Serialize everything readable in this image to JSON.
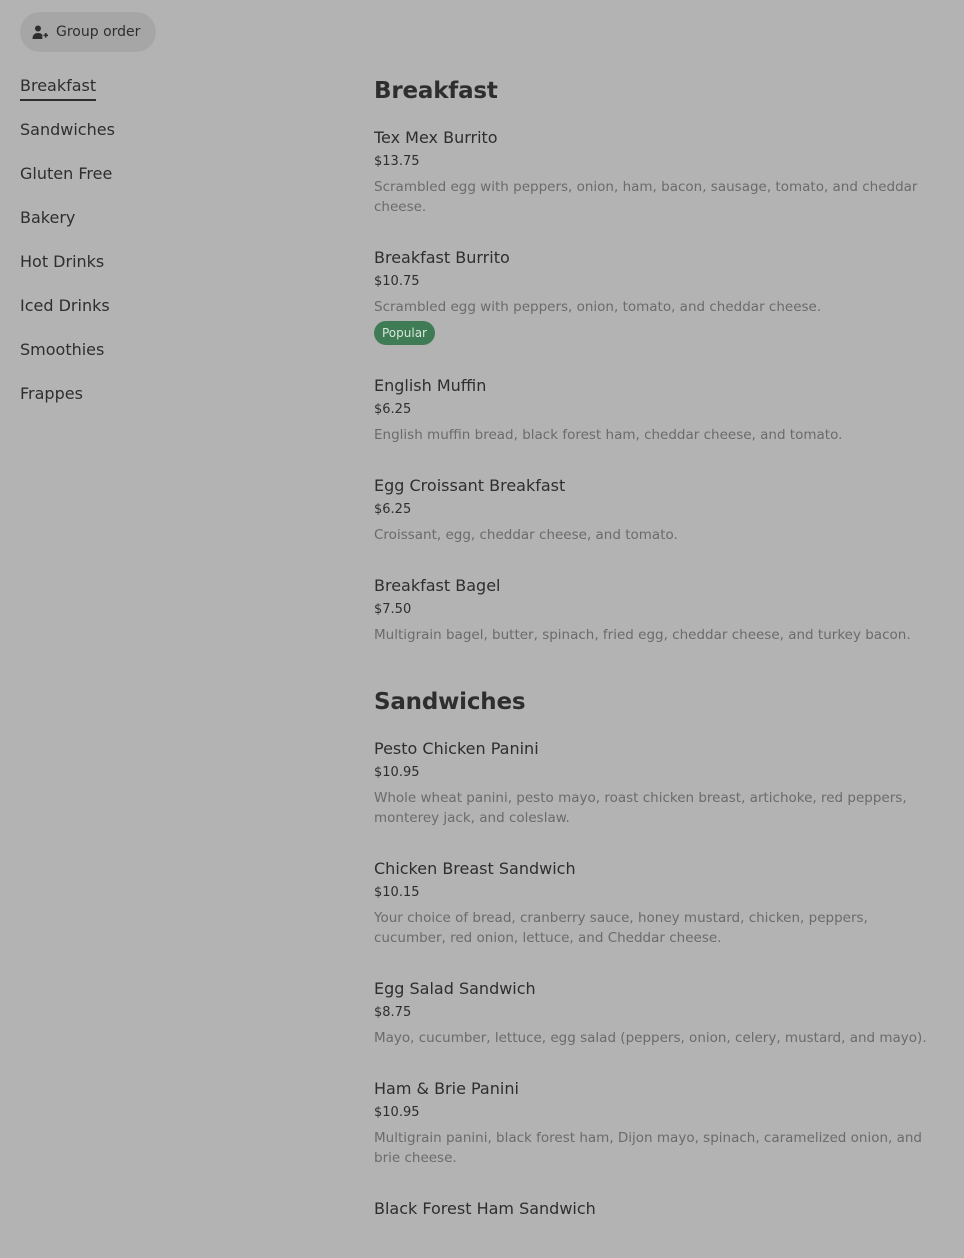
{
  "group_order": {
    "label": "Group order",
    "icon": "person-add-icon"
  },
  "sidebar": {
    "items": [
      {
        "label": "Breakfast",
        "active": true
      },
      {
        "label": "Sandwiches"
      },
      {
        "label": "Gluten Free"
      },
      {
        "label": "Bakery"
      },
      {
        "label": "Hot Drinks"
      },
      {
        "label": "Iced Drinks"
      },
      {
        "label": "Smoothies"
      },
      {
        "label": "Frappes"
      }
    ]
  },
  "sections": [
    {
      "title": "Breakfast",
      "items": [
        {
          "name": "Tex Mex Burrito",
          "price": "$13.75",
          "desc": "Scrambled egg with peppers, onion, ham, bacon, sausage, tomato, and cheddar cheese."
        },
        {
          "name": "Breakfast Burrito",
          "price": "$10.75",
          "desc": "Scrambled egg with peppers, onion, tomato, and cheddar cheese.",
          "badge": "Popular"
        },
        {
          "name": "English Muffin",
          "price": "$6.25",
          "desc": "English muffin bread, black forest ham, cheddar cheese, and tomato."
        },
        {
          "name": "Egg Croissant Breakfast",
          "price": "$6.25",
          "desc": "Croissant, egg, cheddar cheese, and tomato."
        },
        {
          "name": "Breakfast Bagel",
          "price": "$7.50",
          "desc": "Multigrain bagel, butter, spinach, fried egg, cheddar cheese, and turkey bacon."
        }
      ]
    },
    {
      "title": "Sandwiches",
      "items": [
        {
          "name": "Pesto Chicken Panini",
          "price": "$10.95",
          "desc": "Whole wheat panini, pesto mayo, roast chicken breast, artichoke, red peppers, monterey jack, and coleslaw."
        },
        {
          "name": "Chicken Breast Sandwich",
          "price": "$10.15",
          "desc": "Your choice of bread, cranberry sauce, honey mustard, chicken, peppers, cucumber, red onion, lettuce, and Cheddar cheese."
        },
        {
          "name": "Egg Salad Sandwich",
          "price": "$8.75",
          "desc": "Mayo, cucumber, lettuce, egg salad (peppers, onion, celery, mustard, and mayo)."
        },
        {
          "name": "Ham & Brie Panini",
          "price": "$10.95",
          "desc": "Multigrain panini, black forest ham, Dijon mayo, spinach, caramelized onion, and brie cheese."
        },
        {
          "name": "Black Forest Ham Sandwich",
          "price": "",
          "desc": ""
        }
      ]
    }
  ],
  "colors": {
    "background": "#b3b3b3",
    "badge": "#3f7c56",
    "text": "#2e2e2e",
    "muted": "#6b6b6b"
  }
}
